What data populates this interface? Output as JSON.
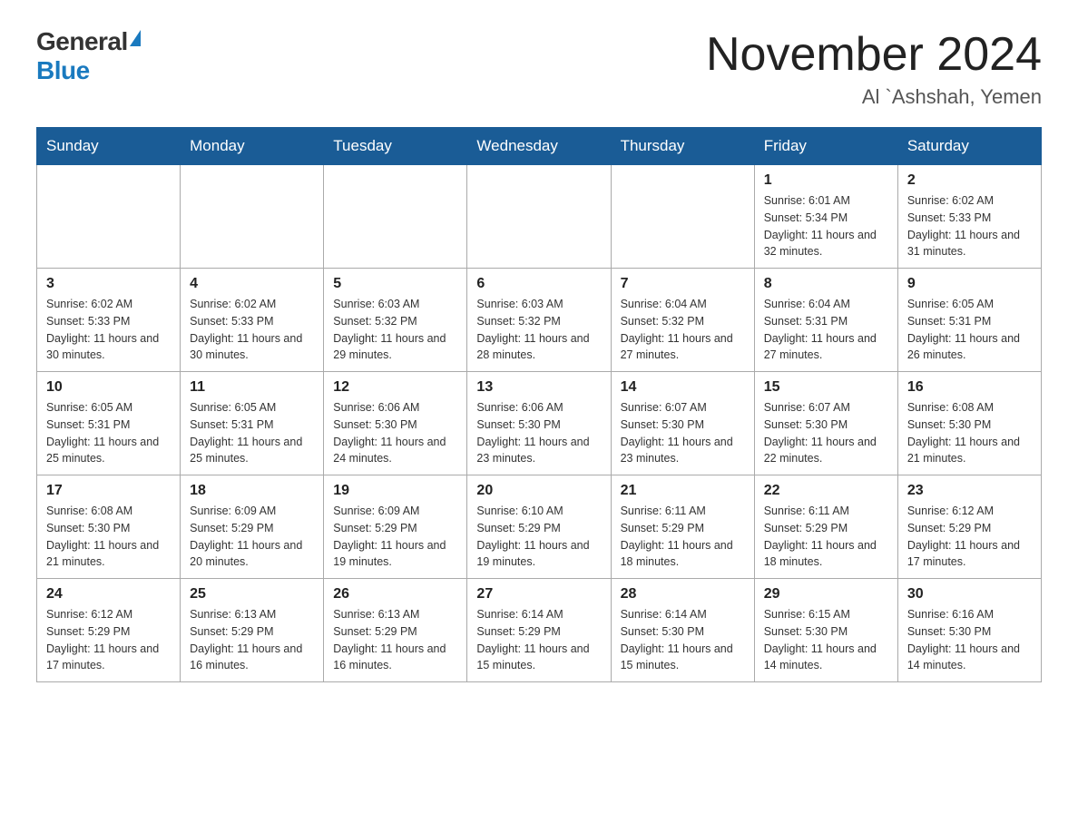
{
  "logo": {
    "general": "General",
    "blue": "Blue"
  },
  "title": "November 2024",
  "subtitle": "Al `Ashshah, Yemen",
  "days_of_week": [
    "Sunday",
    "Monday",
    "Tuesday",
    "Wednesday",
    "Thursday",
    "Friday",
    "Saturday"
  ],
  "weeks": [
    [
      {
        "day": "",
        "info": ""
      },
      {
        "day": "",
        "info": ""
      },
      {
        "day": "",
        "info": ""
      },
      {
        "day": "",
        "info": ""
      },
      {
        "day": "",
        "info": ""
      },
      {
        "day": "1",
        "info": "Sunrise: 6:01 AM\nSunset: 5:34 PM\nDaylight: 11 hours and 32 minutes."
      },
      {
        "day": "2",
        "info": "Sunrise: 6:02 AM\nSunset: 5:33 PM\nDaylight: 11 hours and 31 minutes."
      }
    ],
    [
      {
        "day": "3",
        "info": "Sunrise: 6:02 AM\nSunset: 5:33 PM\nDaylight: 11 hours and 30 minutes."
      },
      {
        "day": "4",
        "info": "Sunrise: 6:02 AM\nSunset: 5:33 PM\nDaylight: 11 hours and 30 minutes."
      },
      {
        "day": "5",
        "info": "Sunrise: 6:03 AM\nSunset: 5:32 PM\nDaylight: 11 hours and 29 minutes."
      },
      {
        "day": "6",
        "info": "Sunrise: 6:03 AM\nSunset: 5:32 PM\nDaylight: 11 hours and 28 minutes."
      },
      {
        "day": "7",
        "info": "Sunrise: 6:04 AM\nSunset: 5:32 PM\nDaylight: 11 hours and 27 minutes."
      },
      {
        "day": "8",
        "info": "Sunrise: 6:04 AM\nSunset: 5:31 PM\nDaylight: 11 hours and 27 minutes."
      },
      {
        "day": "9",
        "info": "Sunrise: 6:05 AM\nSunset: 5:31 PM\nDaylight: 11 hours and 26 minutes."
      }
    ],
    [
      {
        "day": "10",
        "info": "Sunrise: 6:05 AM\nSunset: 5:31 PM\nDaylight: 11 hours and 25 minutes."
      },
      {
        "day": "11",
        "info": "Sunrise: 6:05 AM\nSunset: 5:31 PM\nDaylight: 11 hours and 25 minutes."
      },
      {
        "day": "12",
        "info": "Sunrise: 6:06 AM\nSunset: 5:30 PM\nDaylight: 11 hours and 24 minutes."
      },
      {
        "day": "13",
        "info": "Sunrise: 6:06 AM\nSunset: 5:30 PM\nDaylight: 11 hours and 23 minutes."
      },
      {
        "day": "14",
        "info": "Sunrise: 6:07 AM\nSunset: 5:30 PM\nDaylight: 11 hours and 23 minutes."
      },
      {
        "day": "15",
        "info": "Sunrise: 6:07 AM\nSunset: 5:30 PM\nDaylight: 11 hours and 22 minutes."
      },
      {
        "day": "16",
        "info": "Sunrise: 6:08 AM\nSunset: 5:30 PM\nDaylight: 11 hours and 21 minutes."
      }
    ],
    [
      {
        "day": "17",
        "info": "Sunrise: 6:08 AM\nSunset: 5:30 PM\nDaylight: 11 hours and 21 minutes."
      },
      {
        "day": "18",
        "info": "Sunrise: 6:09 AM\nSunset: 5:29 PM\nDaylight: 11 hours and 20 minutes."
      },
      {
        "day": "19",
        "info": "Sunrise: 6:09 AM\nSunset: 5:29 PM\nDaylight: 11 hours and 19 minutes."
      },
      {
        "day": "20",
        "info": "Sunrise: 6:10 AM\nSunset: 5:29 PM\nDaylight: 11 hours and 19 minutes."
      },
      {
        "day": "21",
        "info": "Sunrise: 6:11 AM\nSunset: 5:29 PM\nDaylight: 11 hours and 18 minutes."
      },
      {
        "day": "22",
        "info": "Sunrise: 6:11 AM\nSunset: 5:29 PM\nDaylight: 11 hours and 18 minutes."
      },
      {
        "day": "23",
        "info": "Sunrise: 6:12 AM\nSunset: 5:29 PM\nDaylight: 11 hours and 17 minutes."
      }
    ],
    [
      {
        "day": "24",
        "info": "Sunrise: 6:12 AM\nSunset: 5:29 PM\nDaylight: 11 hours and 17 minutes."
      },
      {
        "day": "25",
        "info": "Sunrise: 6:13 AM\nSunset: 5:29 PM\nDaylight: 11 hours and 16 minutes."
      },
      {
        "day": "26",
        "info": "Sunrise: 6:13 AM\nSunset: 5:29 PM\nDaylight: 11 hours and 16 minutes."
      },
      {
        "day": "27",
        "info": "Sunrise: 6:14 AM\nSunset: 5:29 PM\nDaylight: 11 hours and 15 minutes."
      },
      {
        "day": "28",
        "info": "Sunrise: 6:14 AM\nSunset: 5:30 PM\nDaylight: 11 hours and 15 minutes."
      },
      {
        "day": "29",
        "info": "Sunrise: 6:15 AM\nSunset: 5:30 PM\nDaylight: 11 hours and 14 minutes."
      },
      {
        "day": "30",
        "info": "Sunrise: 6:16 AM\nSunset: 5:30 PM\nDaylight: 11 hours and 14 minutes."
      }
    ]
  ]
}
